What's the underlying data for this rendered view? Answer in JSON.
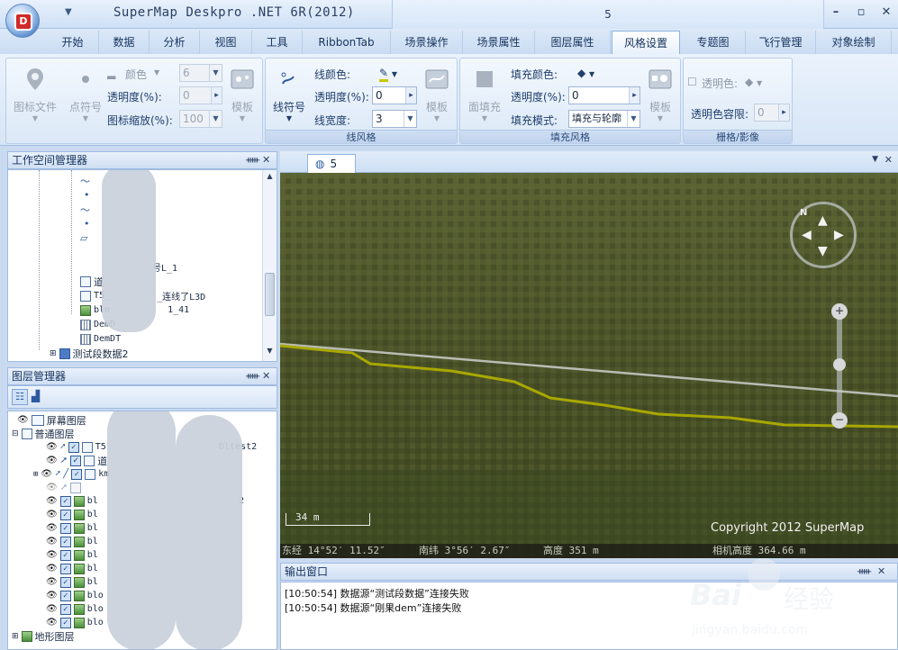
{
  "window": {
    "app_title": "SuperMap Deskpro .NET 6R(2012)",
    "doc_title": "5",
    "controls": {
      "minimize": "–",
      "restore": "▫",
      "close": "✕"
    }
  },
  "ribbon_tabs": [
    {
      "label": "开始"
    },
    {
      "label": "数据"
    },
    {
      "label": "分析"
    },
    {
      "label": "视图"
    },
    {
      "label": "工具"
    },
    {
      "label": "RibbonTab"
    },
    {
      "label": "场景操作"
    },
    {
      "label": "场景属性"
    },
    {
      "label": "图层属性"
    },
    {
      "label": "风格设置",
      "active": true
    },
    {
      "label": "专题图"
    },
    {
      "label": "飞行管理"
    },
    {
      "label": "对象绘制"
    }
  ],
  "ribbon": {
    "point_group": {
      "icon_file_label": "图标文件",
      "point_symbol_label": "点符号",
      "color_label": "颜色",
      "size_value": "6",
      "transparency_label": "透明度(%):",
      "transparency_value": "0",
      "icon_scale_label": "图标缩放(%):",
      "icon_scale_value": "100",
      "template_label": "模板"
    },
    "line_group": {
      "title": "线风格",
      "line_symbol_label": "线符号",
      "line_color_label": "线颜色:",
      "transparency_label": "透明度(%):",
      "transparency_value": "0",
      "line_width_label": "线宽度:",
      "line_width_value": "3",
      "template_label": "模板"
    },
    "fill_group": {
      "title": "填充风格",
      "fill_label": "面填充",
      "fill_color_label": "填充颜色:",
      "transparency_label": "透明度(%):",
      "transparency_value": "0",
      "fill_mode_label": "填充模式:",
      "fill_mode_value": "填充与轮廓",
      "template_label": "模板"
    },
    "raster_group": {
      "title": "栅格/影像",
      "transparent_color_label": "透明色:",
      "tolerance_label": "透明色容限:",
      "tolerance_value": "0"
    }
  },
  "workspace_panel": {
    "title": "工作空间管理器",
    "pin": "ᚔ",
    "close": "✕",
    "items": [
      {
        "label": "T5_",
        "suffix": "_连线了L3D"
      },
      {
        "label": "blo",
        "suffix": "1_41"
      },
      {
        "label": "DemD"
      },
      {
        "label": "DemDT"
      },
      {
        "label": "测试段数据2"
      }
    ],
    "fragments": [
      "号L_1",
      "道"
    ]
  },
  "layer_panel": {
    "title": "图层管理器",
    "pin": "ᚔ",
    "close": "✕",
    "screen_layer": "屏幕图层",
    "normal_layer": "普通图层",
    "terrain_layer": "地形图层",
    "rows": [
      "T5",
      "道",
      "km",
      "bl",
      "bl",
      "bl",
      "bl",
      "bl",
      "bl",
      "bl",
      "blo",
      "blo",
      "blo"
    ],
    "fragments": {
      "top": "Dltest2",
      "mid": "2"
    }
  },
  "scene": {
    "tab_label": "5",
    "copyright": "Copyright 2012 SuperMap",
    "scale_label": "34 m",
    "status": {
      "lon": "东经 14°52′ 11.52″",
      "lat": "南纬 3°56′ 2.67″",
      "alt": "高度 351 m",
      "camera": "相机高度 364.66 m"
    },
    "compass_letter": "N",
    "zoom_in": "+",
    "zoom_out": "−"
  },
  "output_panel": {
    "title": "输出窗口",
    "pin": "ᚔ",
    "close": "✕",
    "lines": [
      "[10:50:54] 数据源“测试段数据”连接失败",
      "[10:50:54] 数据源“刚果dem”连接失败"
    ]
  },
  "watermark": {
    "brand": "Bai",
    "brand_cn": "经验",
    "url": "jingyan.baidu.com"
  }
}
